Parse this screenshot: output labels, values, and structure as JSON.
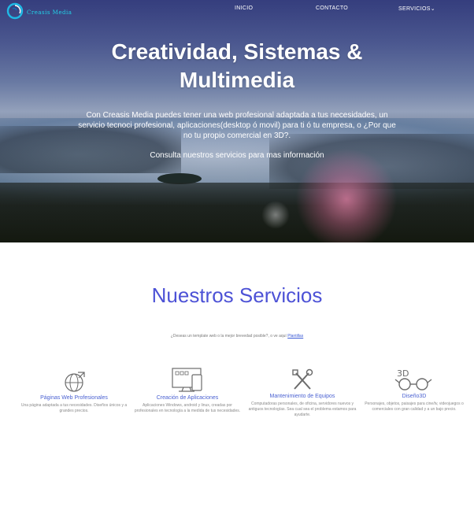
{
  "header": {
    "brand": "Creasis Media",
    "nav": [
      {
        "label": "INICIO"
      },
      {
        "label": "CONTACTO"
      },
      {
        "label": "SERVICIOS"
      }
    ]
  },
  "hero": {
    "title_line1": "Creatividad, Sistemas &",
    "title_line2": "Multimedia",
    "description": "Con Creasis Media puedes tener una web profesional adaptada a tus necesidades, un servicio tecnoci profesional, aplicaciones(desktop ó movil) para ti ó tu empresa, o ¿Por que no tu propio comercial en 3D?.",
    "cta": "Consulta nuestros servicios para mas información"
  },
  "services": {
    "title": "Nuestros Servicios",
    "subtitle": "¿Deseas un template web o la mejor brevedad posible?, o ve aquí",
    "subtitle_link": "Plantillas",
    "items": [
      {
        "icon": "web-globe-icon",
        "title": "Páginas Web Profesionales",
        "desc": "Una página adaptada a tus necesidades. Diseños únicos y a grandes precios."
      },
      {
        "icon": "devices-icon",
        "title": "Creación de Aplicaciones",
        "desc": "Aplicaciones Windows, android y linux, creadas por profesionales en tecnología a la medida de tus necesidades."
      },
      {
        "icon": "tools-icon",
        "title": "Mantenimiento de Equipos",
        "desc": "Computadoras personales, de oficina, servidores nuevos y antiguos tecnologías. Sea cual sea el problema estamos para ayudarte."
      },
      {
        "icon": "3d-glasses-icon",
        "title": "Diseño3D",
        "desc": "Personajes, objetos, paisajes para cine/tv, videojuegos o comerciales con gran calidad y a un bajo precio."
      }
    ]
  },
  "colors": {
    "accent": "#4d52d6",
    "link": "#3b5bd6",
    "brand": "#22d3e8"
  }
}
